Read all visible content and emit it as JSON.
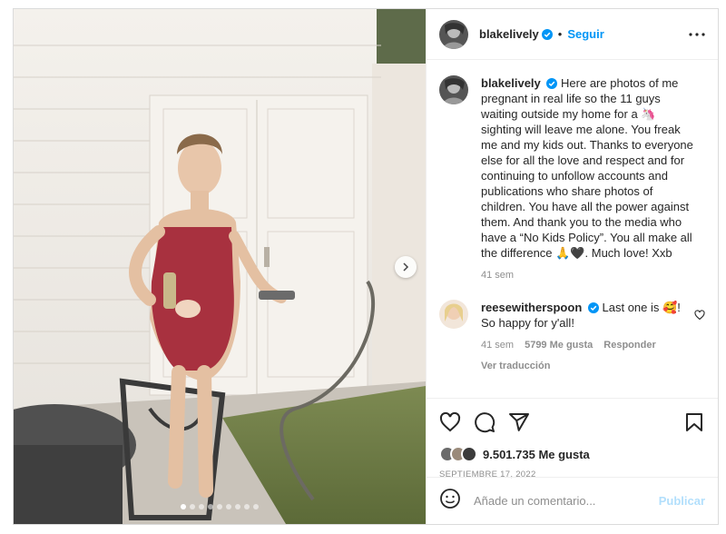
{
  "post": {
    "username": "blakelively",
    "follow_label": "Seguir",
    "separator": "•"
  },
  "caption": {
    "username": "blakelively",
    "text": "Here are photos of me pregnant in real life so the 11 guys waiting outside my home for a 🦄 sighting will leave me alone. You freak me and my kids out. Thanks to everyone else for all the love and respect and for continuing to unfollow accounts and publications who share photos of children. You have all the power against them. And thank you to the media who have a “No Kids Policy”. You all make all the difference 🙏🖤. Much love! Xxb",
    "time": "41 sem"
  },
  "comment": {
    "username": "reesewitherspoon",
    "text": "Last one is 🥰! So happy for y'all!",
    "time": "41 sem",
    "likes": "5799 Me gusta",
    "reply_label": "Responder",
    "translate_label": "Ver traducción"
  },
  "likes": {
    "count_text": "9.501.735 Me gusta",
    "date": "SEPTIEMBRE 17, 2022"
  },
  "add_comment": {
    "placeholder": "Añade un comentario...",
    "publish_label": "Publicar"
  },
  "carousel": {
    "slides": 9,
    "active": 0
  },
  "colors": {
    "accent": "#0095f6",
    "verified": "#0095f6",
    "publish_disabled": "#b2dffc",
    "swimsuit": "#a8313f"
  },
  "icons": [
    "verified-badge-icon",
    "more-options-icon",
    "heart-icon",
    "comment-icon",
    "share-icon",
    "bookmark-icon",
    "emoji-icon",
    "chevron-right-icon"
  ]
}
